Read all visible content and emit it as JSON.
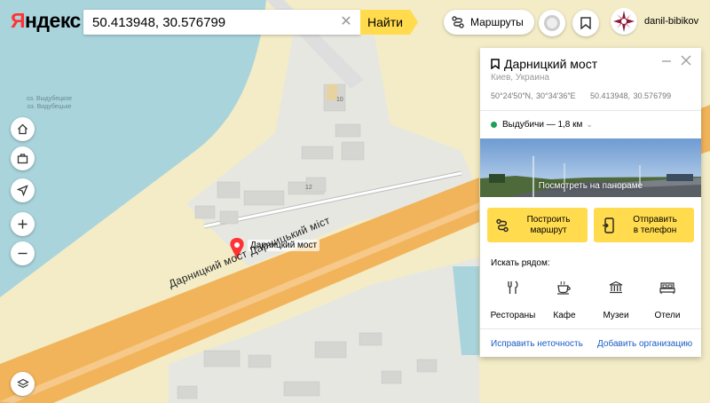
{
  "header": {
    "logo_first": "Я",
    "logo_rest": "ндекс",
    "search_value": "50.413948, 30.576799",
    "find_label": "Найти",
    "routes_label": "Маршруты",
    "username": "danil-bibikov"
  },
  "map": {
    "lake_label_1": "оз. Выдубецкое",
    "lake_label_2": "оз. Видубецьке",
    "place_label": "Дарницкий мост",
    "road_label": "Дарницкий мост Дарницький міст",
    "building_10": "10",
    "building_12": "12"
  },
  "card": {
    "title": "Дарницкий мост",
    "subtitle": "Киев, Украина",
    "coords_dms": "50°24′50″N, 30°34′36″E",
    "coords_decimal": "50.413948, 30.576799",
    "metro": "Выдубичи — 1,8 км",
    "panorama_label": "Посмотреть на панораме",
    "build_route": [
      "Построить",
      "маршрут"
    ],
    "send_phone": [
      "Отправить",
      "в телефон"
    ],
    "nearby_title": "Искать рядом:",
    "nearby": [
      "Рестораны",
      "Кафе",
      "Музеи",
      "Отели"
    ],
    "link_fix": "Исправить неточность",
    "link_add": "Добавить организацию",
    "metro_color": "#1ba25a",
    "accent": "#ffdb4d"
  }
}
